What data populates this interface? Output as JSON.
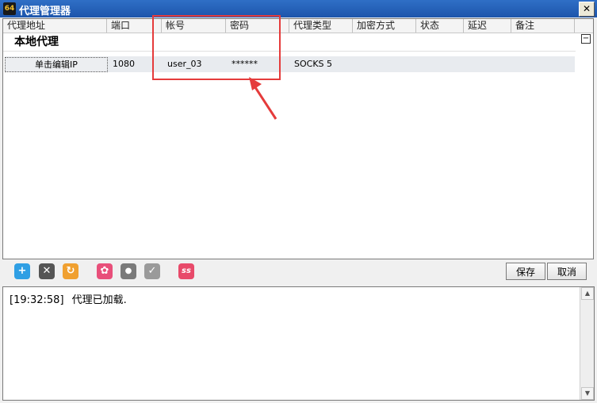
{
  "window": {
    "app_icon_text": "64",
    "title": "代理管理器",
    "close_label": "✕"
  },
  "table": {
    "columns": [
      "代理地址",
      "端口",
      "帐号",
      "密码",
      "代理类型",
      "加密方式",
      "状态",
      "延迟",
      "备注"
    ],
    "group": {
      "title": "本地代理",
      "collapse_label": "−"
    },
    "rows": [
      {
        "address": "单击编辑IP",
        "port": "1080",
        "account": "user_03",
        "password": "******",
        "type": "SOCKS 5",
        "encryption": "",
        "status": "",
        "latency": "",
        "note": ""
      }
    ]
  },
  "toolbar": {
    "icons": [
      {
        "name": "add-icon",
        "glyph": "+",
        "color": "#2f9fe4"
      },
      {
        "name": "delete-icon",
        "glyph": "✕",
        "color": "#555555"
      },
      {
        "name": "refresh-icon",
        "glyph": "↻",
        "color": "#f0a030"
      },
      {
        "name": "settings-icon",
        "glyph": "✿",
        "color": "#e84f7a"
      },
      {
        "name": "bulb-icon",
        "glyph": "●",
        "color": "#7a7a7a"
      },
      {
        "name": "check-icon",
        "glyph": "✓",
        "color": "#9a9a9a"
      },
      {
        "name": "ss-icon",
        "glyph": "ss",
        "color": "#e84a6a"
      }
    ],
    "save_label": "保存",
    "cancel_label": "取消"
  },
  "log": {
    "timestamp": "[19:32:58]",
    "message": "代理已加载."
  },
  "scroll": {
    "up_arrow": "▲",
    "down_arrow": "▼"
  },
  "colors": {
    "title_bar": "#1d55ab",
    "annotation": "#e53b3b",
    "row_background": "#e8ebef"
  }
}
